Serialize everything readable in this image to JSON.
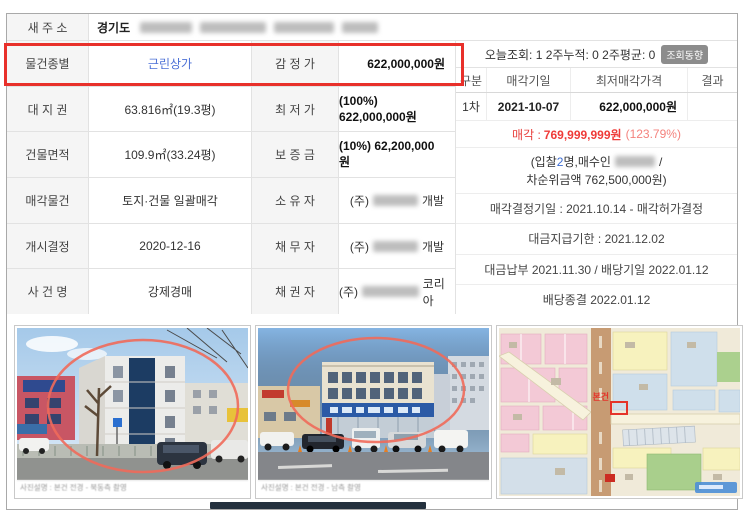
{
  "colors": {
    "annotation_red": "#e8302a",
    "link_blue": "#4b6fd6",
    "sale_red": "#ef3b38",
    "badge_gray": "#8c8c8c"
  },
  "address": {
    "label": "새 주 소",
    "province": "경기도"
  },
  "left_table": {
    "rows": [
      {
        "l1": "물건종별",
        "v1": "근린상가",
        "l2": "감 정 가",
        "v2": "622,000,000원"
      },
      {
        "l1": "대 지 권",
        "v1": "63.816㎡(19.3평)",
        "l2": "최 저 가",
        "v2": "(100%) 622,000,000원"
      },
      {
        "l1": "건물면적",
        "v1": "109.9㎡(33.24평)",
        "l2": "보 증 금",
        "v2": "(10%) 62,200,000원"
      },
      {
        "l1": "매각물건",
        "v1": "토지·건물 일괄매각",
        "l2": "소 유 자",
        "v2_prefix": "(주)",
        "v2_suffix": "개발"
      },
      {
        "l1": "개시결정",
        "v1": "2020-12-16",
        "l2": "채 무 자",
        "v2_prefix": "(주)",
        "v2_suffix": "개발"
      },
      {
        "l1": "사 건 명",
        "v1": "강제경매",
        "l2": "채 권 자",
        "v2_prefix": "(주)",
        "v2_suffix": "코리아"
      }
    ]
  },
  "views": {
    "text": "오늘조회: 1  2주누적: 0  2주평균: 0",
    "badge": "조회동향"
  },
  "auction": {
    "headers": [
      "구분",
      "매각기일",
      "최저매각가격",
      "결과"
    ],
    "row": {
      "round": "1차",
      "date": "2021-10-07",
      "price": "622,000,000원",
      "result": ""
    }
  },
  "sale_result": {
    "label": "매각 :",
    "amount": "769,999,999원",
    "percent": "(123.79%)"
  },
  "bid": {
    "pre": "(입찰",
    "count": "2",
    "mid": "명,매수인",
    "tail": " /",
    "line2": "차순위금액 762,500,000원)"
  },
  "schedule": [
    "매각결정기일 : 2021.10.14 - 매각허가결정",
    "대금지급기한 : 2021.12.02",
    "대금납부 2021.11.30 / 배당기일 2022.01.12",
    "배당종결 2022.01.12"
  ],
  "photos": {
    "caption1": "사진설명 : 본건 전경 - 북동측 촬영",
    "caption2": "사진설명 : 본건 전경 - 남측 촬영",
    "map_subject_label": "본건"
  }
}
